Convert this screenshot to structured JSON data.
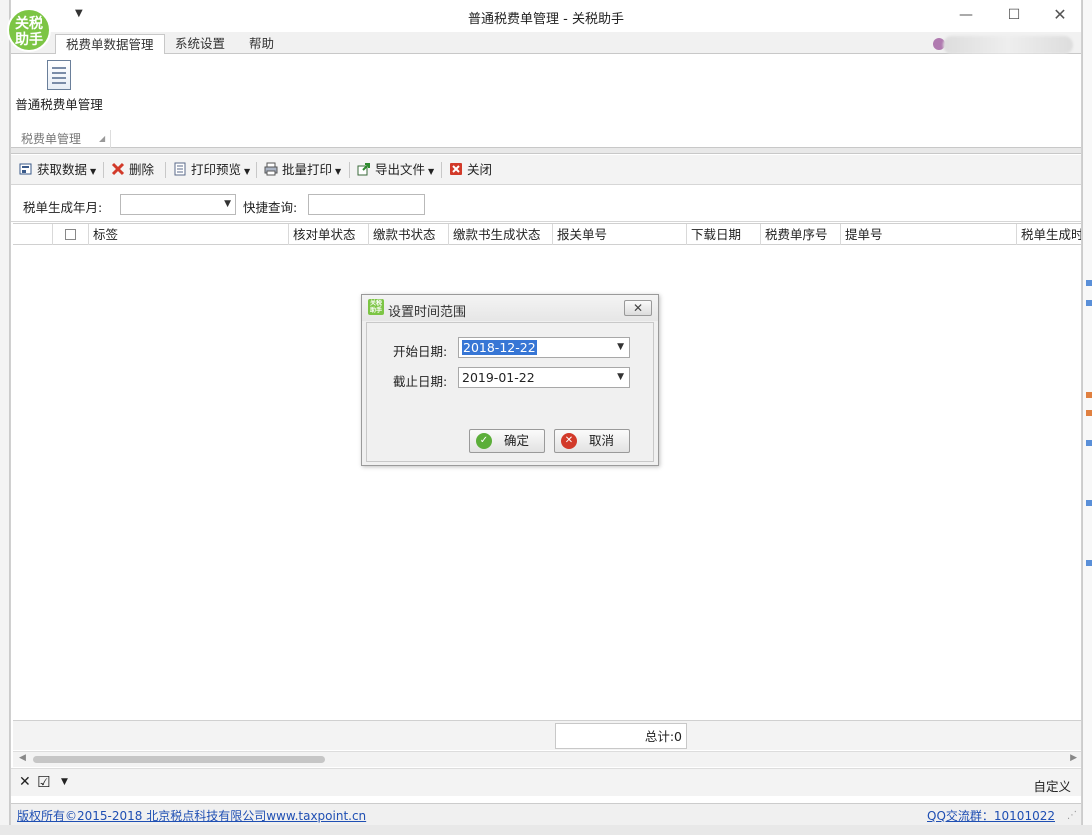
{
  "window": {
    "title": "普通税费单管理 - 关税助手",
    "logo_text": "关税\n助手"
  },
  "ribbon": {
    "tabs": [
      "税费单数据管理",
      "系统设置",
      "帮助"
    ],
    "big_button_label": "普通税费单管理",
    "group_label": "税费单管理"
  },
  "toolbar": {
    "fetch": "获取数据",
    "delete": "删除",
    "print_preview": "打印预览",
    "batch_print": "批量打印",
    "export": "导出文件",
    "close": "关闭"
  },
  "filter": {
    "month_label": "税单生成年月:",
    "month_value": "",
    "quick_label": "快捷查询:",
    "quick_value": ""
  },
  "grid": {
    "columns": [
      "标签",
      "核对单状态",
      "缴款书状态",
      "缴款书生成状态",
      "报关单号",
      "下载日期",
      "税费单序号",
      "提单号",
      "税单生成时"
    ]
  },
  "summary": {
    "total_text": "总计:0"
  },
  "filterbar": {
    "custom_label": "自定义"
  },
  "status": {
    "copyright": "版权所有©2015-2018 北京税点科技有限公司www.taxpoint.cn",
    "qq": "QQ交流群：10101022"
  },
  "dialog": {
    "title": "设置时间范围",
    "start_label": "开始日期:",
    "start_value": "2018-12-22",
    "end_label": "截止日期:",
    "end_value": "2019-01-22",
    "ok_label": "确定",
    "cancel_label": "取消"
  },
  "colors": {
    "brand_green": "#7cc544",
    "link_blue": "#1f4fb3",
    "selection_blue": "#3776d5"
  }
}
